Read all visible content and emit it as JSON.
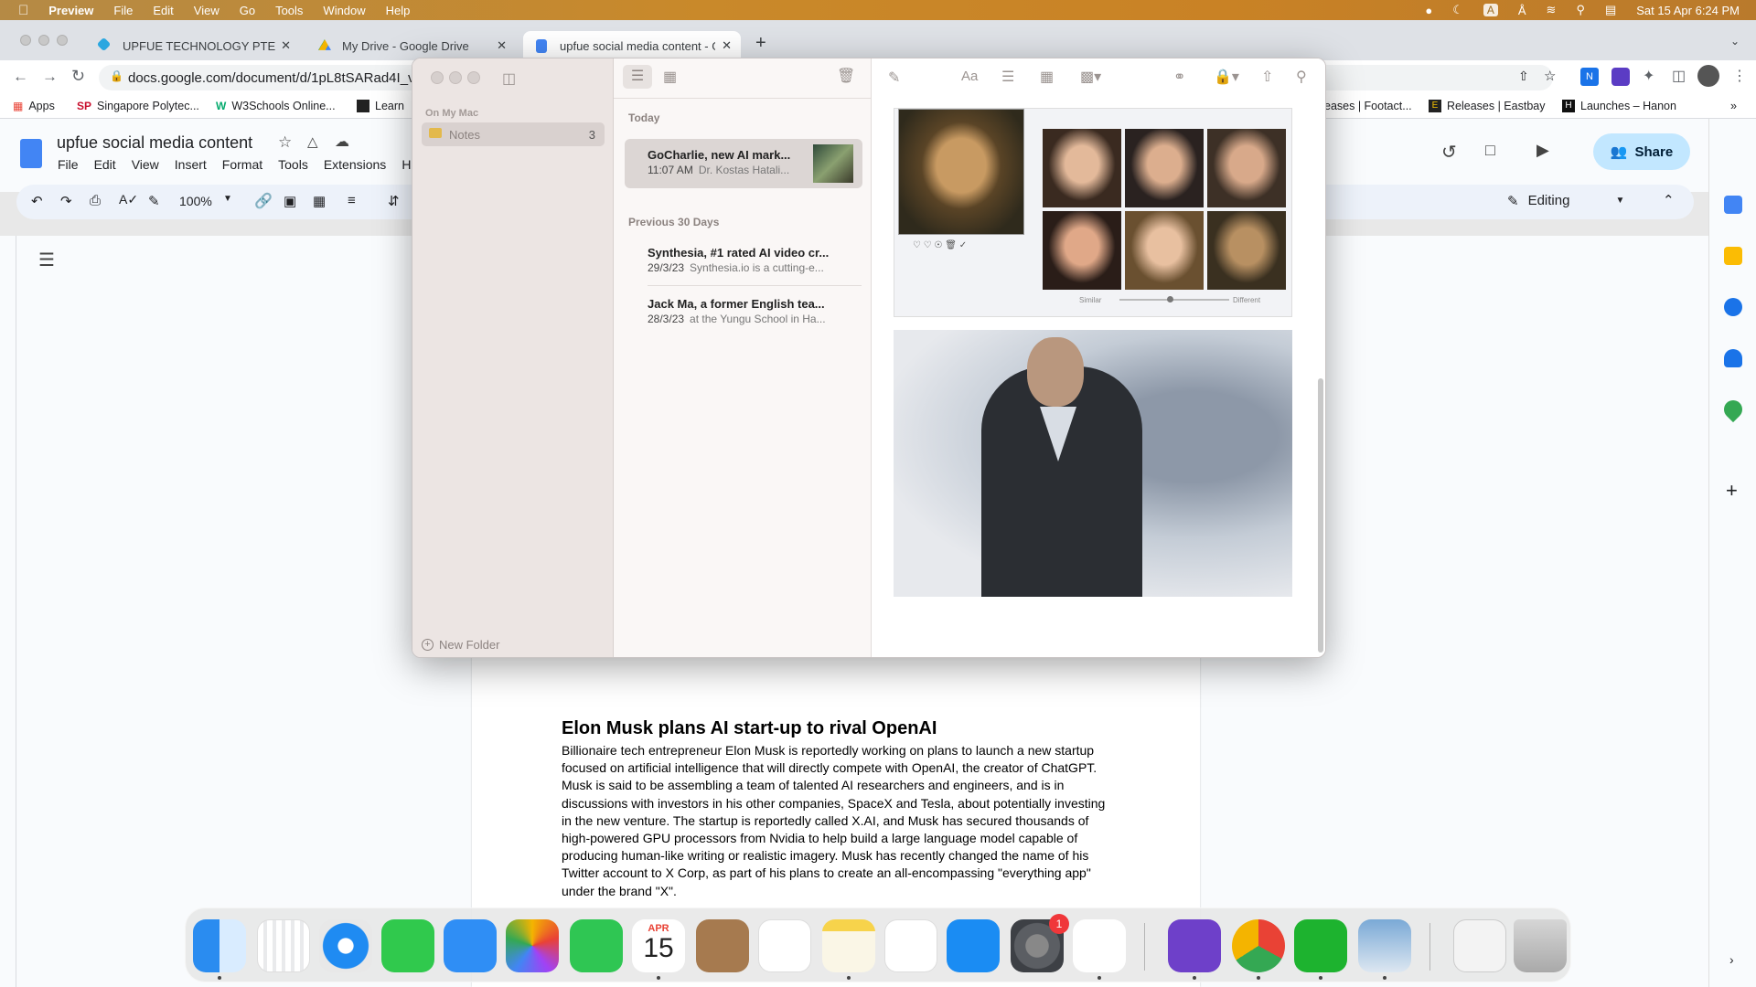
{
  "menubar": {
    "app": "Preview",
    "items": [
      "File",
      "Edit",
      "View",
      "Go",
      "Tools",
      "Window",
      "Help"
    ],
    "clock": "Sat 15 Apr  6:24 PM",
    "input_badge": "A"
  },
  "chrome": {
    "tabs": [
      {
        "title": "UPFUE TECHNOLOGY PTE LTD",
        "color": "#2aa7e0"
      },
      {
        "title": "My Drive - Google Drive",
        "color": "#f4b400"
      },
      {
        "title": "upfue social media content - G",
        "color": "#4285f4"
      }
    ],
    "url": "docs.google.com/document/d/1pL8tSARad4I_v",
    "bookmarks": [
      {
        "label": "Apps"
      },
      {
        "label": "Singapore Polytec...",
        "badge": "SP"
      },
      {
        "label": "W3Schools Online...",
        "badge": "W"
      },
      {
        "label": "Learn"
      },
      {
        "label": "eases | Footact..."
      },
      {
        "label": "Releases | Eastbay"
      },
      {
        "label": "Launches – Hanon"
      }
    ]
  },
  "docs": {
    "title": "upfue social media content",
    "menu": [
      "File",
      "Edit",
      "View",
      "Insert",
      "Format",
      "Tools",
      "Extensions",
      "H"
    ],
    "zoom": "100%",
    "share": "Share",
    "mode": "Editing",
    "heading": "Elon Musk plans AI start-up to rival OpenAI",
    "body": "Billionaire tech entrepreneur Elon Musk is reportedly working on plans to launch a new startup focused on artificial intelligence that will directly compete with OpenAI, the creator of ChatGPT. Musk is said to be assembling a team of talented AI researchers and engineers, and is in discussions with investors in his other companies, SpaceX and Tesla, about potentially investing in the new venture. The startup is reportedly called X.AI, and Musk has secured thousands of high-powered GPU processors from Nvidia to help build a large language model capable of producing human-like writing or realistic imagery. Musk has recently changed the name of his Twitter account to X Corp, as part of his plans to create an all-encompassing \"everything app\" under the brand \"X\"."
  },
  "notes": {
    "section": "On My Mac",
    "folder": "Notes",
    "folder_count": "3",
    "new_folder": "New Folder",
    "groups": [
      {
        "label": "Today",
        "items": [
          {
            "title": "GoCharlie, new AI mark...",
            "time": "11:07 AM",
            "preview": "Dr. Kostas Hatali..."
          }
        ]
      },
      {
        "label": "Previous 30 Days",
        "items": [
          {
            "title": "Synthesia, #1 rated AI video cr...",
            "time": "29/3/23",
            "preview": "Synthesia.io is a cutting-e..."
          },
          {
            "title": "Jack Ma, a former English tea...",
            "time": "28/3/23",
            "preview": "at the Yungu School in Ha..."
          }
        ]
      }
    ],
    "image_caption_left": "Similar",
    "image_caption_right": "Different"
  },
  "dock": {
    "apps": [
      "Finder",
      "Launchpad",
      "Safari",
      "Messages",
      "Mail",
      "Photos",
      "FaceTime",
      "Calendar",
      "Contacts",
      "Reminders",
      "Notes",
      "Freeform",
      "App Store",
      "System Settings",
      "VS Code",
      "GitHub Desktop",
      "Chrome",
      "WeChat",
      "Preview",
      "Photo",
      "Trash"
    ],
    "calendar_month": "APR",
    "calendar_day": "15",
    "settings_badge": "1"
  }
}
